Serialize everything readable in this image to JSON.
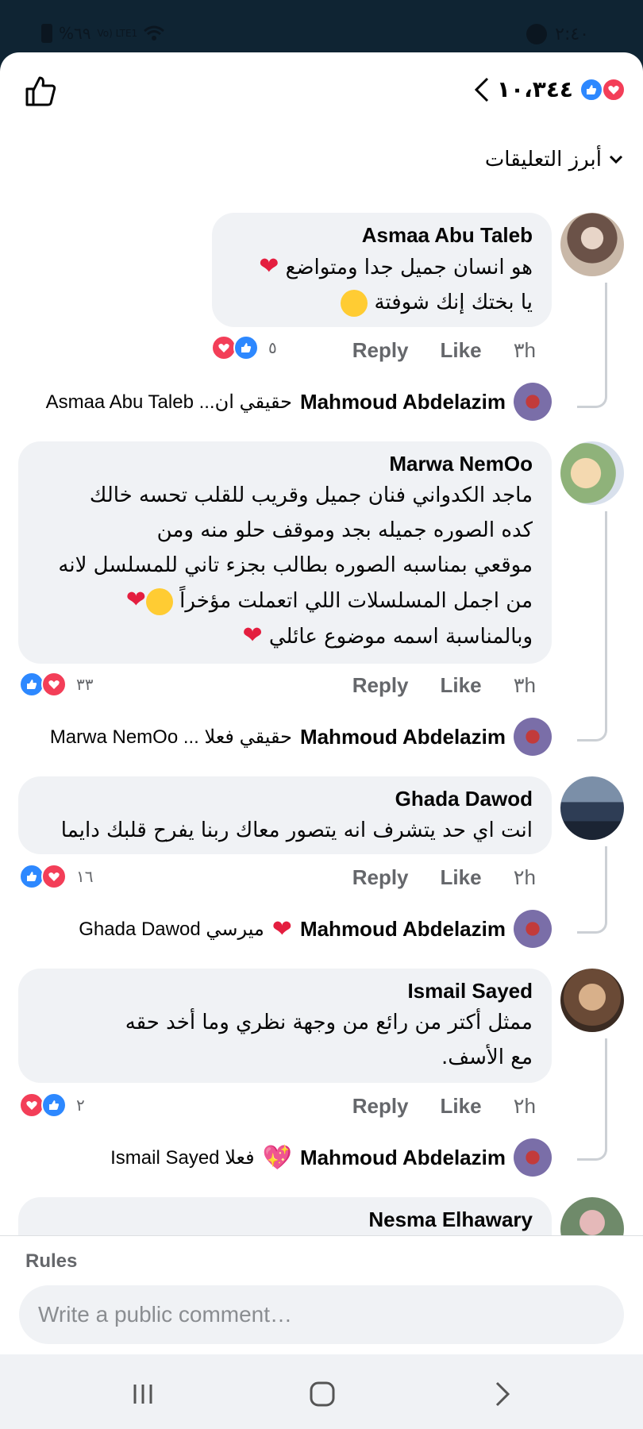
{
  "status_bar": {
    "time": "٢:٤٠",
    "battery": "%٦٩",
    "network": "Vo) LTE1"
  },
  "header": {
    "reaction_count": "١٠،٣٤٤"
  },
  "sort": {
    "label": "أبرز التعليقات"
  },
  "comments": [
    {
      "author": "Asmaa Abu Taleb",
      "lines": [
        "هو انسان جميل جدا ومتواضع",
        "يا بختك إنك شوفتة"
      ],
      "time": "٣h",
      "like": "Like",
      "reply": "Reply",
      "reactions": "٥",
      "reply_author": "Mahmoud Abdelazim",
      "reply_snippet": "Asmaa Abu Taleb ...حقيقي ان"
    },
    {
      "author": "Marwa NemOo",
      "lines": [
        "ماجد الكدواني فنان جميل وقريب للقلب تحسه خالك",
        "كده  الصوره جميله بجد وموقف حلو منه ومن",
        "موقعي بمناسبه الصوره بطالب بجزء تاني للمسلسل لانه",
        "من اجمل المسلسلات اللي اتعملت مؤخراً",
        "وبالمناسبة اسمه موضوع عائلي"
      ],
      "time": "٣h",
      "like": "Like",
      "reply": "Reply",
      "reactions": "٣٣",
      "reply_author": "Mahmoud Abdelazim",
      "reply_snippet": "Marwa NemOo ... حقيقي فعلا"
    },
    {
      "author": "Ghada Dawod",
      "lines": [
        "انت اي حد يتشرف انه يتصور معاك ربنا يفرح قلبك دايما"
      ],
      "time": "٢h",
      "like": "Like",
      "reply": "Reply",
      "reactions": "١٦",
      "reply_author": "Mahmoud Abdelazim",
      "reply_snippet": "Ghada Dawod ميرسي"
    },
    {
      "author": "Ismail Sayed",
      "lines": [
        "ممثل أكتر من رائع من وجهة نظري  وما أخد حقه",
        "مع الأسف."
      ],
      "time": "٢h",
      "like": "Like",
      "reply": "Reply",
      "reactions": "٢",
      "reply_author": "Mahmoud Abdelazim",
      "reply_snippet": "Ismail Sayed فعلا"
    },
    {
      "author": "Nesma Elhawary"
    }
  ],
  "footer": {
    "rules": "Rules",
    "placeholder": "Write a public comment…"
  },
  "colors": {
    "like_blue": "#2d88ff",
    "love_red": "#f33e58",
    "bubble": "#f0f2f5",
    "muted": "#65676b"
  }
}
